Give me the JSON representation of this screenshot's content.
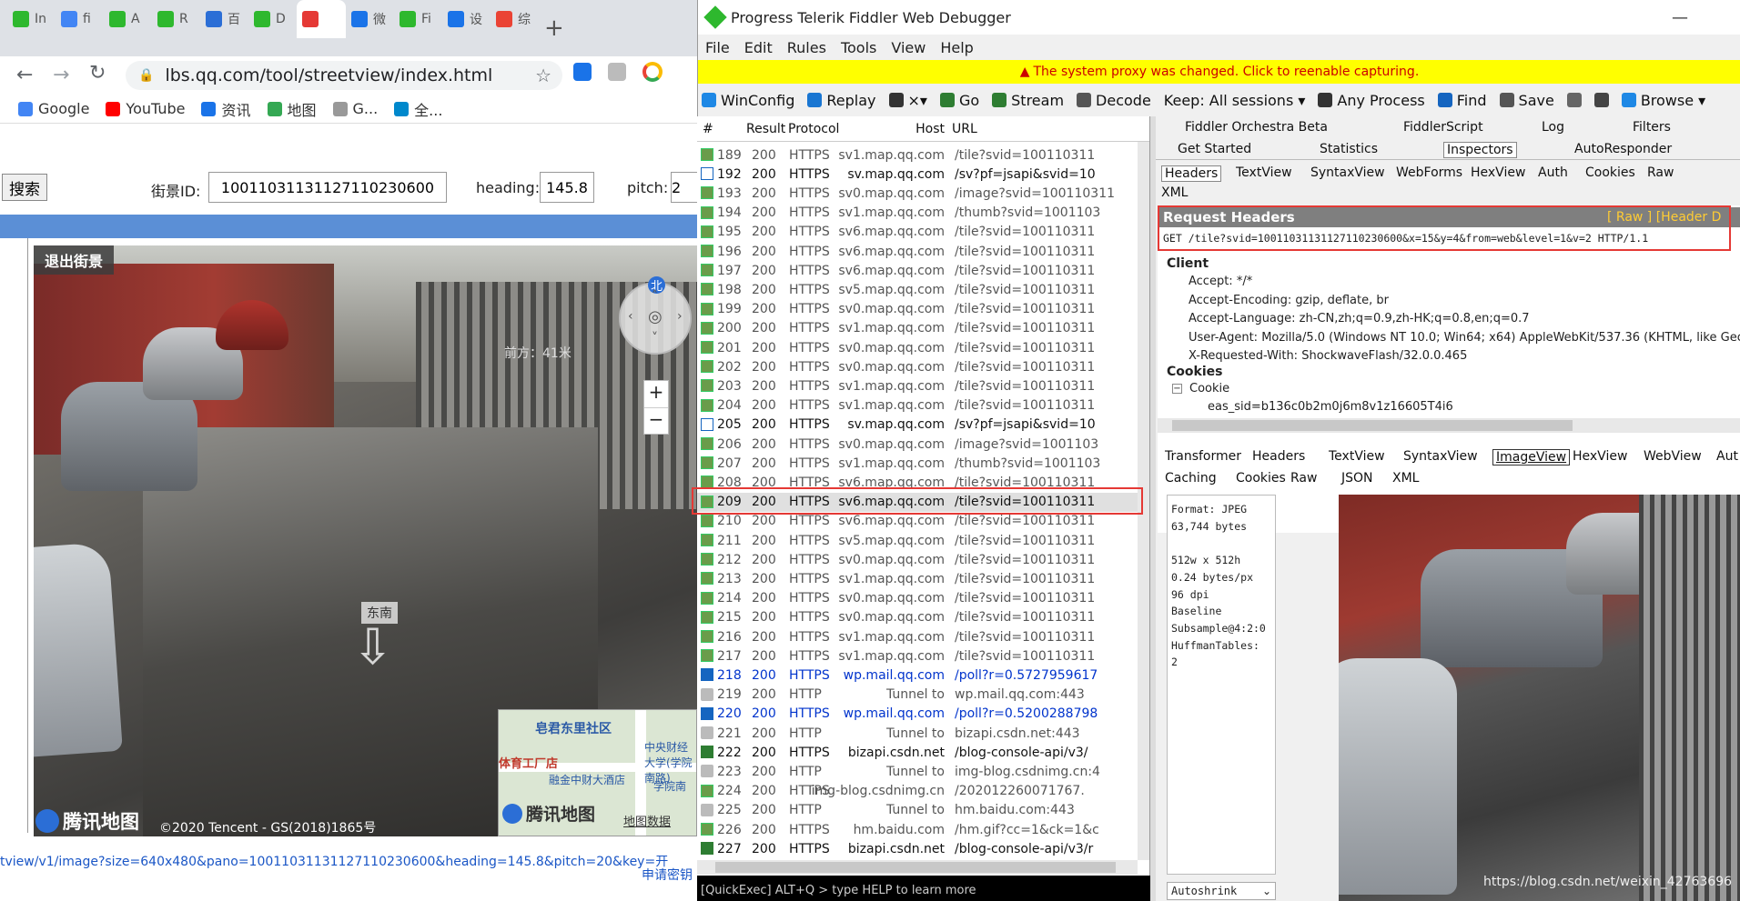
{
  "browser": {
    "tabs": [
      "In",
      "fi",
      "A",
      "R",
      "百",
      "D",
      "",
      "微",
      "Fi",
      "设",
      "综"
    ],
    "new_tab": "+",
    "url": "lbs.qq.com/tool/streetview/index.html",
    "bookmarks": [
      {
        "label": "Google",
        "color": "#4285f4"
      },
      {
        "label": "YouTube",
        "color": "#ff0000"
      },
      {
        "label": "资讯",
        "color": "#1a73e8"
      },
      {
        "label": "地图",
        "color": "#34a853"
      },
      {
        "label": "G...",
        "color": "#999999"
      },
      {
        "label": "全...",
        "color": "#0088cc"
      }
    ]
  },
  "streetview": {
    "search_button": "搜索",
    "pano_label": "街景ID:",
    "pano_value": "10011031131127110230600",
    "heading_label": "heading:",
    "heading_value": "145.8",
    "pitch_label": "pitch:",
    "pitch_value": "2",
    "exit_label": "退出街景",
    "compass_north": "北",
    "distance_text": "前方：41米",
    "zoom_in": "+",
    "zoom_out": "−",
    "direction_label": "东南",
    "logo_text": "腾讯地图",
    "copyright": "©2020 Tencent - GS(2018)1865号",
    "minimap_labels": [
      "皂君东里社区",
      "体育工厂店",
      "融金中财大酒店",
      "中央财经大学(学院南路)",
      "学院南"
    ],
    "minimap_logo": "腾讯地图",
    "minimap_data": "地图数据",
    "url_preview": "tview/v1/image?size=640x480&pano=10011031131127110230600&heading=145.8&pitch=20&key=开",
    "apply_key": "申请密钥"
  },
  "fiddler": {
    "title": "Progress Telerik Fiddler Web Debugger",
    "menu": [
      "File",
      "Edit",
      "Rules",
      "Tools",
      "View",
      "Help"
    ],
    "notice": "The system proxy was changed. Click to reenable capturing.",
    "toolbar": [
      {
        "label": "WinConfig",
        "icon": "windows-icon"
      },
      {
        "label": "Replay",
        "icon": "replay-icon"
      },
      {
        "label": "×▾",
        "icon": "remove-icon"
      },
      {
        "label": "Go",
        "icon": "go-icon"
      },
      {
        "label": "Stream",
        "icon": "stream-icon"
      },
      {
        "label": "Decode",
        "icon": "decode-icon"
      },
      {
        "label": "Keep: All sessions ▾",
        "icon": ""
      },
      {
        "label": "Any Process",
        "icon": "crosshair-icon"
      },
      {
        "label": "Find",
        "icon": "binoculars-icon"
      },
      {
        "label": "Save",
        "icon": "save-icon"
      },
      {
        "label": "",
        "icon": "camera-icon"
      },
      {
        "label": "",
        "icon": "timer-icon"
      },
      {
        "label": "Browse ▾",
        "icon": "ie-icon"
      }
    ],
    "columns": [
      "#",
      "Result",
      "Protocol",
      "Host",
      "URL"
    ],
    "sessions": [
      {
        "id": "189",
        "result": "200",
        "protocol": "HTTPS",
        "host": "sv1.map.qq.com",
        "url": "/tile?svid=100110311",
        "style": "grey",
        "icon": "image"
      },
      {
        "id": "192",
        "result": "200",
        "protocol": "HTTPS",
        "host": "sv.map.qq.com",
        "url": "/sv?pf=jsapi&svid=10",
        "style": "dark",
        "icon": "script"
      },
      {
        "id": "193",
        "result": "200",
        "protocol": "HTTPS",
        "host": "sv0.map.qq.com",
        "url": "/image?svid=100110311",
        "style": "grey",
        "icon": "image"
      },
      {
        "id": "194",
        "result": "200",
        "protocol": "HTTPS",
        "host": "sv1.map.qq.com",
        "url": "/thumb?svid=1001103",
        "style": "grey",
        "icon": "image"
      },
      {
        "id": "195",
        "result": "200",
        "protocol": "HTTPS",
        "host": "sv6.map.qq.com",
        "url": "/tile?svid=100110311",
        "style": "grey",
        "icon": "image"
      },
      {
        "id": "196",
        "result": "200",
        "protocol": "HTTPS",
        "host": "sv6.map.qq.com",
        "url": "/tile?svid=100110311",
        "style": "grey",
        "icon": "image"
      },
      {
        "id": "197",
        "result": "200",
        "protocol": "HTTPS",
        "host": "sv6.map.qq.com",
        "url": "/tile?svid=100110311",
        "style": "grey",
        "icon": "image"
      },
      {
        "id": "198",
        "result": "200",
        "protocol": "HTTPS",
        "host": "sv5.map.qq.com",
        "url": "/tile?svid=100110311",
        "style": "grey",
        "icon": "image"
      },
      {
        "id": "199",
        "result": "200",
        "protocol": "HTTPS",
        "host": "sv0.map.qq.com",
        "url": "/tile?svid=100110311",
        "style": "grey",
        "icon": "image"
      },
      {
        "id": "200",
        "result": "200",
        "protocol": "HTTPS",
        "host": "sv1.map.qq.com",
        "url": "/tile?svid=100110311",
        "style": "grey",
        "icon": "image"
      },
      {
        "id": "201",
        "result": "200",
        "protocol": "HTTPS",
        "host": "sv0.map.qq.com",
        "url": "/tile?svid=100110311",
        "style": "grey",
        "icon": "image"
      },
      {
        "id": "202",
        "result": "200",
        "protocol": "HTTPS",
        "host": "sv0.map.qq.com",
        "url": "/tile?svid=100110311",
        "style": "grey",
        "icon": "image"
      },
      {
        "id": "203",
        "result": "200",
        "protocol": "HTTPS",
        "host": "sv1.map.qq.com",
        "url": "/tile?svid=100110311",
        "style": "grey",
        "icon": "image"
      },
      {
        "id": "204",
        "result": "200",
        "protocol": "HTTPS",
        "host": "sv1.map.qq.com",
        "url": "/tile?svid=100110311",
        "style": "grey",
        "icon": "image"
      },
      {
        "id": "205",
        "result": "200",
        "protocol": "HTTPS",
        "host": "sv.map.qq.com",
        "url": "/sv?pf=jsapi&svid=10",
        "style": "dark",
        "icon": "script"
      },
      {
        "id": "206",
        "result": "200",
        "protocol": "HTTPS",
        "host": "sv0.map.qq.com",
        "url": "/image?svid=1001103",
        "style": "grey",
        "icon": "image"
      },
      {
        "id": "207",
        "result": "200",
        "protocol": "HTTPS",
        "host": "sv1.map.qq.com",
        "url": "/thumb?svid=1001103",
        "style": "grey",
        "icon": "image"
      },
      {
        "id": "208",
        "result": "200",
        "protocol": "HTTPS",
        "host": "sv6.map.qq.com",
        "url": "/tile?svid=100110311",
        "style": "grey",
        "icon": "image"
      },
      {
        "id": "209",
        "result": "200",
        "protocol": "HTTPS",
        "host": "sv6.map.qq.com",
        "url": "/tile?svid=100110311",
        "style": "selected",
        "icon": "image"
      },
      {
        "id": "210",
        "result": "200",
        "protocol": "HTTPS",
        "host": "sv6.map.qq.com",
        "url": "/tile?svid=100110311",
        "style": "grey",
        "icon": "image"
      },
      {
        "id": "211",
        "result": "200",
        "protocol": "HTTPS",
        "host": "sv5.map.qq.com",
        "url": "/tile?svid=100110311",
        "style": "grey",
        "icon": "image"
      },
      {
        "id": "212",
        "result": "200",
        "protocol": "HTTPS",
        "host": "sv0.map.qq.com",
        "url": "/tile?svid=100110311",
        "style": "grey",
        "icon": "image"
      },
      {
        "id": "213",
        "result": "200",
        "protocol": "HTTPS",
        "host": "sv1.map.qq.com",
        "url": "/tile?svid=100110311",
        "style": "grey",
        "icon": "image"
      },
      {
        "id": "214",
        "result": "200",
        "protocol": "HTTPS",
        "host": "sv0.map.qq.com",
        "url": "/tile?svid=100110311",
        "style": "grey",
        "icon": "image"
      },
      {
        "id": "215",
        "result": "200",
        "protocol": "HTTPS",
        "host": "sv0.map.qq.com",
        "url": "/tile?svid=100110311",
        "style": "grey",
        "icon": "image"
      },
      {
        "id": "216",
        "result": "200",
        "protocol": "HTTPS",
        "host": "sv1.map.qq.com",
        "url": "/tile?svid=100110311",
        "style": "grey",
        "icon": "image"
      },
      {
        "id": "217",
        "result": "200",
        "protocol": "HTTPS",
        "host": "sv1.map.qq.com",
        "url": "/tile?svid=100110311",
        "style": "grey",
        "icon": "image"
      },
      {
        "id": "218",
        "result": "200",
        "protocol": "HTTPS",
        "host": "wp.mail.qq.com",
        "url": "/poll?r=0.5727959617",
        "style": "blue",
        "icon": "arrows"
      },
      {
        "id": "219",
        "result": "200",
        "protocol": "HTTP",
        "host": "Tunnel to",
        "url": "wp.mail.qq.com:443",
        "style": "grey",
        "icon": "lock"
      },
      {
        "id": "220",
        "result": "200",
        "protocol": "HTTPS",
        "host": "wp.mail.qq.com",
        "url": "/poll?r=0.5200288798",
        "style": "blue",
        "icon": "arrows"
      },
      {
        "id": "221",
        "result": "200",
        "protocol": "HTTP",
        "host": "Tunnel to",
        "url": "bizapi.csdn.net:443",
        "style": "grey",
        "icon": "lock"
      },
      {
        "id": "222",
        "result": "200",
        "protocol": "HTTPS",
        "host": "bizapi.csdn.net",
        "url": "/blog-console-api/v3/",
        "style": "dark",
        "icon": "go"
      },
      {
        "id": "223",
        "result": "200",
        "protocol": "HTTP",
        "host": "Tunnel to",
        "url": "img-blog.csdnimg.cn:4",
        "style": "grey",
        "icon": "lock"
      },
      {
        "id": "224",
        "result": "200",
        "protocol": "HTTPS",
        "host": "img-blog.csdnimg.cn",
        "url": "/202012260071767.",
        "style": "grey",
        "icon": "image"
      },
      {
        "id": "225",
        "result": "200",
        "protocol": "HTTP",
        "host": "Tunnel to",
        "url": "hm.baidu.com:443",
        "style": "grey",
        "icon": "lock"
      },
      {
        "id": "226",
        "result": "200",
        "protocol": "HTTPS",
        "host": "hm.baidu.com",
        "url": "/hm.gif?cc=1&ck=1&c",
        "style": "grey",
        "icon": "image"
      },
      {
        "id": "227",
        "result": "200",
        "protocol": "HTTPS",
        "host": "bizapi.csdn.net",
        "url": "/blog-console-api/v3/r",
        "style": "dark",
        "icon": "go"
      }
    ],
    "quickexec": "[QuickExec] ALT+Q > type HELP to learn more",
    "tabs_row1": [
      "Fiddler Orchestra Beta",
      "FiddlerScript",
      "Log",
      "Filters"
    ],
    "tabs_row2": [
      "Get Started",
      "Statistics",
      "Inspectors",
      "AutoResponder"
    ],
    "req_tabs": [
      "Headers",
      "TextView",
      "SyntaxView",
      "WebForms",
      "HexView",
      "Auth",
      "Cookies",
      "Raw",
      "XML"
    ],
    "req_headers_title": "Request Headers",
    "req_headers_links": "[ Raw ]   [Header D",
    "request_line": "GET /tile?svid=10011031131127110230600&x=15&y=4&from=web&level=1&v=2 HTTP/1.1",
    "client_label": "Client",
    "headers": [
      "Accept: */*",
      "Accept-Encoding: gzip, deflate, br",
      "Accept-Language: zh-CN,zh;q=0.9,zh-HK;q=0.8,en;q=0.7",
      "User-Agent: Mozilla/5.0 (Windows NT 10.0; Win64; x64) AppleWebKit/537.36 (KHTML, like Gecko) Ch",
      "X-Requested-With: ShockwaveFlash/32.0.0.465"
    ],
    "cookies_label": "Cookies",
    "cookie_node": "Cookie",
    "cookie_value": "eas_sid=b136c0b2m0j6m8v1z16605T4i6",
    "resp_tabs1": [
      "Transformer",
      "Headers",
      "TextView",
      "SyntaxView",
      "ImageView",
      "HexView",
      "WebView",
      "Aut"
    ],
    "resp_tabs2": [
      "Caching",
      "Cookies",
      "Raw",
      "JSON",
      "XML"
    ],
    "image_info": [
      "Format: JPEG",
      "63,744 bytes",
      "",
      "512w x 512h",
      "0.24 bytes/px",
      "96 dpi",
      "Baseline",
      "Subsample@4:2:0",
      "HuffmanTables:",
      "2"
    ],
    "autoshrink": "Autoshrink",
    "watermark": "https://blog.csdn.net/weixin_42763696"
  },
  "colors": {
    "highlight_red": "#e53935",
    "notice_yellow": "#ffff00",
    "blue_band": "#5b8fd6",
    "fiddler_bg": "#f0f0f0"
  }
}
